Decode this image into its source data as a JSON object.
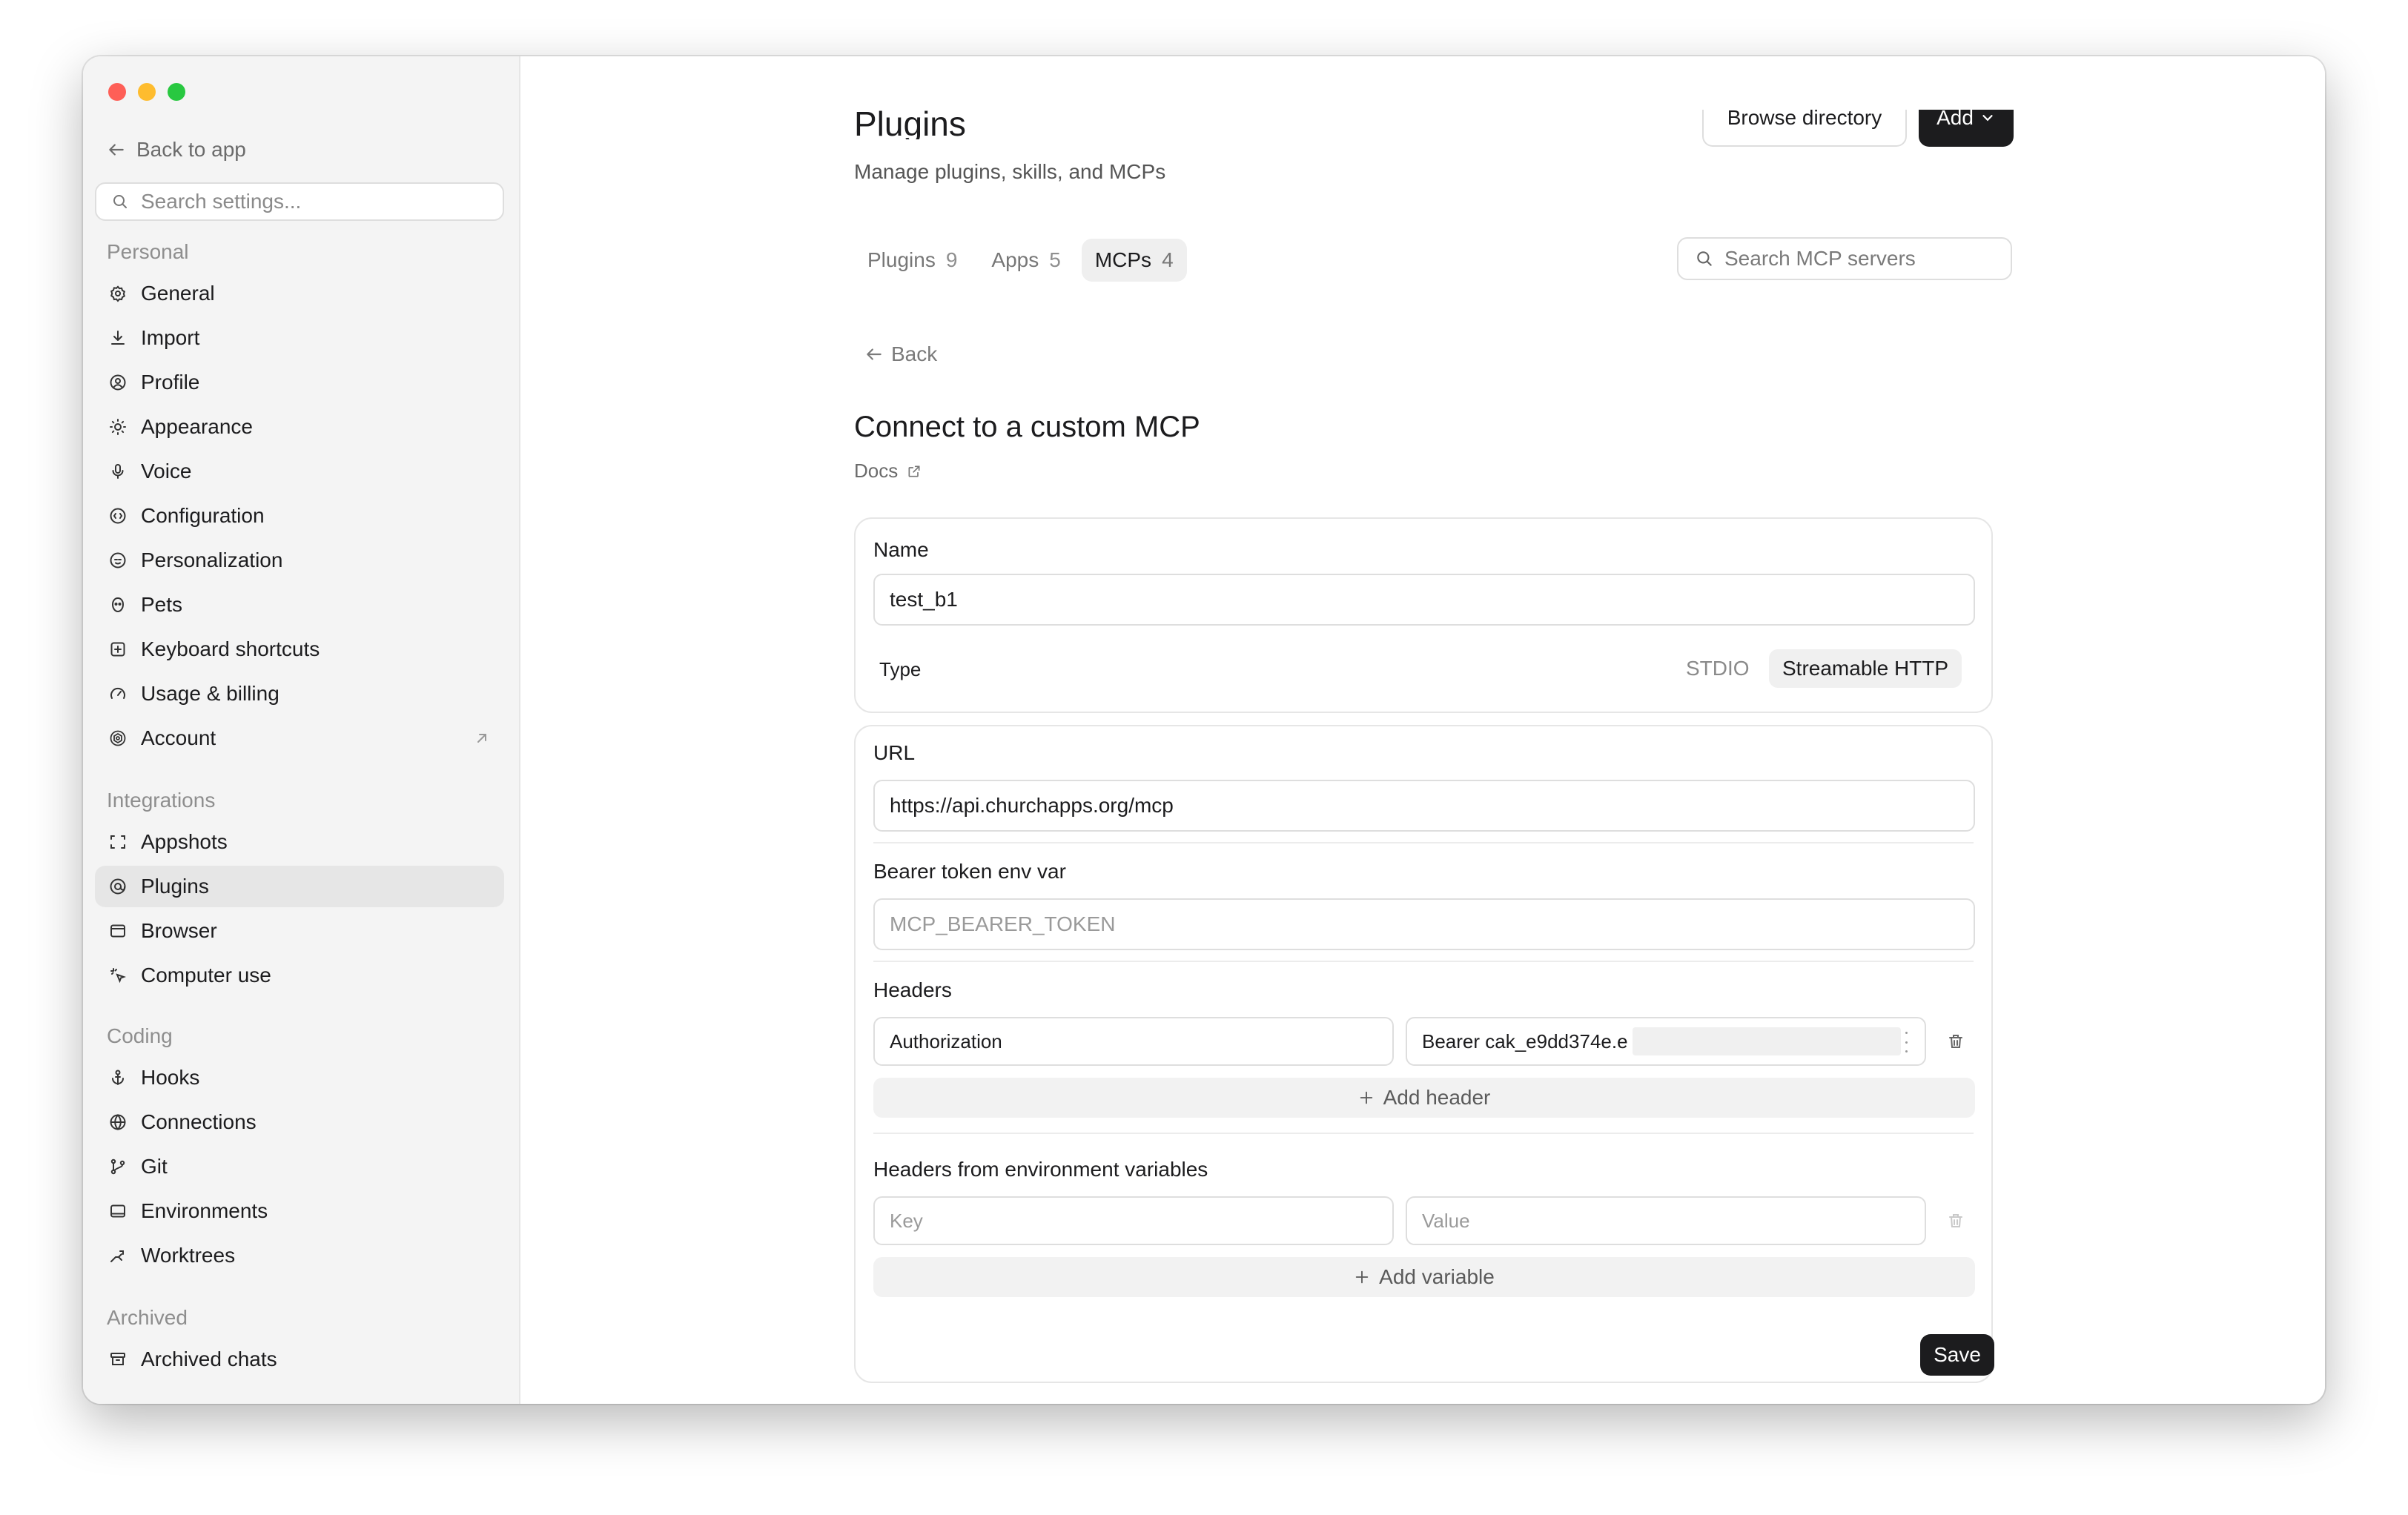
{
  "sidebar": {
    "back_to_app": "Back to app",
    "search_placeholder": "Search settings...",
    "personal_heading": "Personal",
    "personal_items": [
      "General",
      "Import",
      "Profile",
      "Appearance",
      "Voice",
      "Configuration",
      "Personalization",
      "Pets",
      "Keyboard shortcuts",
      "Usage & billing",
      "Account"
    ],
    "integrations_heading": "Integrations",
    "integrations_items": [
      "Appshots",
      "Plugins",
      "Browser",
      "Computer use"
    ],
    "coding_heading": "Coding",
    "coding_items": [
      "Hooks",
      "Connections",
      "Git",
      "Environments",
      "Worktrees"
    ],
    "archived_heading": "Archived",
    "archived_items": [
      "Archived chats"
    ],
    "active_item": "Plugins"
  },
  "header": {
    "title": "Plugins",
    "subtitle": "Manage plugins, skills, and MCPs",
    "browse_button": "Browse directory",
    "add_button": "Add"
  },
  "tabs": [
    {
      "label": "Plugins",
      "count": "9"
    },
    {
      "label": "Apps",
      "count": "5"
    },
    {
      "label": "MCPs",
      "count": "4"
    }
  ],
  "active_tab": "MCPs",
  "mcp_search_placeholder": "Search MCP servers",
  "back_label": "Back",
  "form": {
    "title": "Connect to a custom MCP",
    "docs_label": "Docs",
    "name_label": "Name",
    "name_value": "test_b1",
    "type_label": "Type",
    "type_options": [
      "STDIO",
      "Streamable HTTP"
    ],
    "type_selected": "Streamable HTTP",
    "url_label": "URL",
    "url_value": "https://api.churchapps.org/mcp",
    "bearer_label": "Bearer token env var",
    "bearer_placeholder": "MCP_BEARER_TOKEN",
    "headers_label": "Headers",
    "header_key": "Authorization",
    "header_value": "Bearer cak_e9dd374e.e",
    "add_header": "Add header",
    "env_headers_label": "Headers from environment variables",
    "env_key_placeholder": "Key",
    "env_value_placeholder": "Value",
    "add_variable": "Add variable",
    "save_button": "Save"
  },
  "colors": {
    "sidebar_bg": "#f4f4f4",
    "primary_button": "#1c1c1e",
    "active_item_bg": "#e6e6e6",
    "close": "#fe5f57",
    "minimize": "#febc2e",
    "zoom": "#28c840"
  }
}
